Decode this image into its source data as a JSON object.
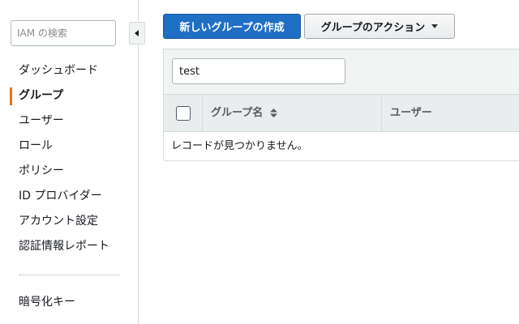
{
  "sidebar": {
    "search_placeholder": "IAM の検索",
    "items": [
      {
        "label": "ダッシュボード"
      },
      {
        "label": "グループ"
      },
      {
        "label": "ユーザー"
      },
      {
        "label": "ロール"
      },
      {
        "label": "ポリシー"
      },
      {
        "label": "ID プロバイダー"
      },
      {
        "label": "アカウント設定"
      },
      {
        "label": "認証情報レポート"
      }
    ],
    "active_item": "グループ",
    "extra_items": [
      {
        "label": "暗号化キー"
      }
    ]
  },
  "toolbar": {
    "create_group_label": "新しいグループの作成",
    "group_actions_label": "グループのアクション"
  },
  "filter": {
    "value": "test"
  },
  "table": {
    "columns": [
      {
        "label": "グループ名"
      },
      {
        "label": "ユーザー"
      }
    ],
    "empty_message": "レコードが見つかりません。"
  },
  "colors": {
    "primary_button": "#1f6fc5",
    "active_marker": "#ec7211"
  },
  "icons": {
    "collapse": "chevron-left-icon",
    "dropdown": "caret-down-icon",
    "sort": "sort-icon"
  }
}
